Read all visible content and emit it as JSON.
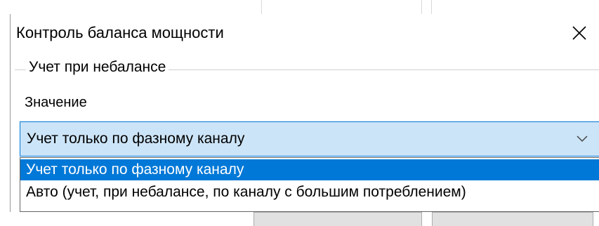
{
  "dialog": {
    "title": "Контроль баланса мощности",
    "close_icon": "close-x-icon"
  },
  "group": {
    "legend": "Учет при небалансе",
    "field_label": "Значение"
  },
  "combo": {
    "selected_value": "Учет только по фазному каналу",
    "chevron_icon": "chevron-down-icon",
    "state": "open"
  },
  "dropdown": {
    "options": [
      {
        "label": "Учет только по фазному каналу",
        "selected": true
      },
      {
        "label": "Авто (учет, при небалансе, по каналу с большим потреблением)",
        "selected": false
      }
    ]
  },
  "colors": {
    "accent": "#0078d7",
    "combo_bg": "#cce4f7",
    "selected_text": "#ffffff"
  }
}
